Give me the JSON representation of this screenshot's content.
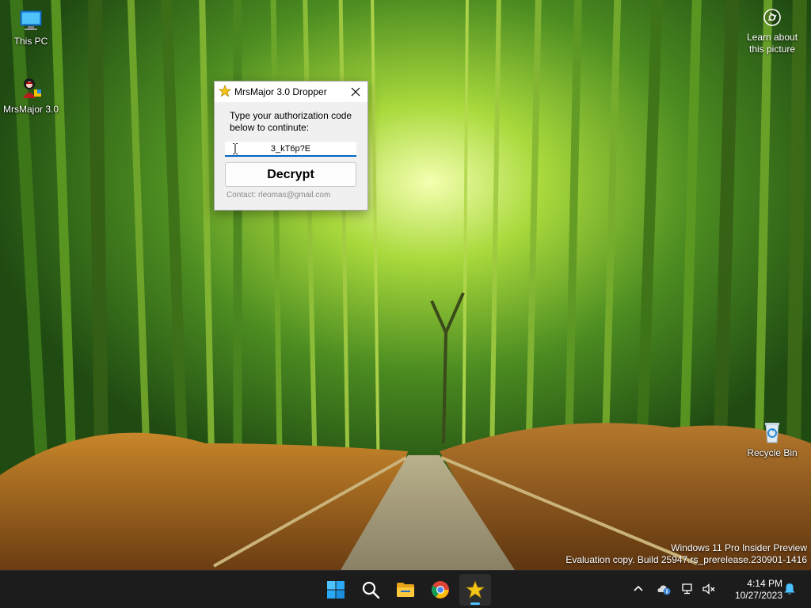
{
  "desktop": {
    "icons": [
      {
        "label": "This PC",
        "icon": "monitor-icon"
      },
      {
        "label": "MrsMajor 3.0",
        "icon": "app-icon"
      },
      {
        "label": "Recycle Bin",
        "icon": "recycle-bin-icon"
      }
    ],
    "spotlight": {
      "label": "Learn about this picture",
      "icon": "camera-icon"
    },
    "watermark": {
      "line1": "Windows 11 Pro Insider Preview",
      "line2": "Evaluation copy. Build 25947.rs_prerelease.230901-1416"
    }
  },
  "dialog": {
    "title": "MrsMajor 3.0 Dropper",
    "prompt_line1": "Type your authorization code",
    "prompt_line2": "below to continute:",
    "code_value": "3_kT6p?E",
    "decrypt_label": "Decrypt",
    "contact": "Contact: rleomas@gmail.com"
  },
  "taskbar": {
    "apps": [
      {
        "name": "Start",
        "icon": "windows-logo-icon"
      },
      {
        "name": "Search",
        "icon": "search-icon"
      },
      {
        "name": "File Explorer",
        "icon": "folder-icon"
      },
      {
        "name": "Google Chrome",
        "icon": "chrome-icon"
      },
      {
        "name": "MrsMajor 3.0 Dropper",
        "icon": "star-icon",
        "active": true
      }
    ],
    "time": "4:14 PM",
    "date": "10/27/2023"
  },
  "colors": {
    "accent": "#0067c0",
    "taskbar": "#1c1c1c",
    "active_indicator": "#4cc2ff"
  }
}
